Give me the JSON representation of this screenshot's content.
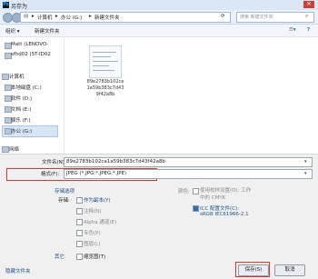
{
  "window": {
    "title": "另存为",
    "app_icon": "Ps"
  },
  "address": {
    "crumbs": [
      "计算机",
      "办公 (G:)",
      "新建文件夹"
    ],
    "separator": "▸",
    "search_placeholder": "搜索 新建文件夹"
  },
  "toolbar": {
    "organize": "组织 ▾",
    "new_folder": "新建文件夹"
  },
  "sidebar": {
    "items": [
      {
        "label": "Matt (LENOVO-"
      },
      {
        "label": "sfhd02 (ST-ID02"
      },
      {
        "label": "计算机"
      },
      {
        "label": "本地磁盘 (C:)"
      },
      {
        "label": "软件 (D:)"
      },
      {
        "label": "文档 (E:)"
      },
      {
        "label": "娱乐 (F:)"
      },
      {
        "label": "办公 (G:)"
      },
      {
        "label": "网络"
      }
    ]
  },
  "file": {
    "caption_lines": [
      "89e2783b102ce",
      "1a59b383c7d43",
      "9f42a8b"
    ]
  },
  "form": {
    "filename_label": "文件名(N):",
    "filename_value": "89e2783b102ca1a59b383c7d43f42a8b",
    "format_label": "格式(F):",
    "format_value": "JPEG (*.JPG;*.JPEG;*.JPE)"
  },
  "options": {
    "section_title": "存储选项",
    "store_label": "存储:",
    "as_copy": "作为副本(Y)",
    "annotations": "注释(N)",
    "alpha": "Alpha 通道(E)",
    "spot": "专色(P)",
    "layers": "图层(L)",
    "color_label": "颜色:",
    "proof_setup": "使用校样设置(O): 工作中的 CMYK",
    "icc": "ICC 配置文件(C):",
    "icc_value": "sRGB IEC61966-2.1",
    "other_label": "其它",
    "thumbnail": "缩览图(T)"
  },
  "footer": {
    "hide_folders": "隐藏文件夹",
    "save": "保存(S)",
    "cancel": "取消"
  }
}
